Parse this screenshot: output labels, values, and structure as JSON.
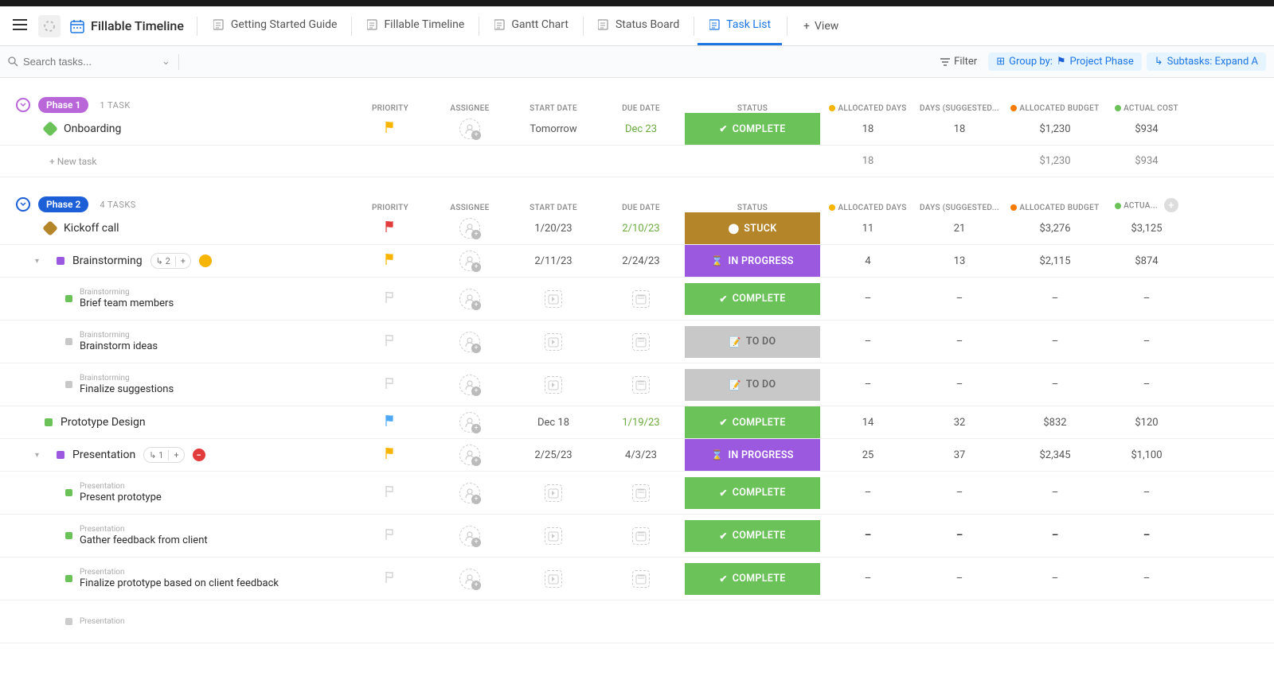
{
  "topbar": {
    "title": "Fillable Timeline",
    "tabs": [
      {
        "label": "Getting Started Guide"
      },
      {
        "label": "Fillable Timeline"
      },
      {
        "label": "Gantt Chart"
      },
      {
        "label": "Status Board"
      },
      {
        "label": "Task List",
        "active": true
      }
    ],
    "view": "View"
  },
  "filters": {
    "search_placeholder": "Search tasks...",
    "filter": "Filter",
    "group_by": "Group by:",
    "group_value": "Project Phase",
    "subtasks": "Subtasks: Expand A"
  },
  "columns": {
    "priority": "PRIORITY",
    "assignee": "ASSIGNEE",
    "start": "START DATE",
    "due": "DUE DATE",
    "status": "STATUS",
    "alloc_days": "ALLOCATED DAYS",
    "sugg_days": "DAYS (SUGGESTED...",
    "alloc_budget": "ALLOCATED BUDGET",
    "actual": "ACTUAL COST",
    "actual_short": "ACTUA..."
  },
  "colors": {
    "complete": "#6AC259",
    "stuck": "#B5852A",
    "inprogress": "#9B59E0",
    "todo": "#C8C8C8",
    "phase1": "#B866D8",
    "phase2": "#1C5FD6",
    "flag_yellow": "#F7B500",
    "flag_red": "#E23B3B",
    "flag_blue": "#4FA8F6"
  },
  "sections": [
    {
      "id": "phase1",
      "badge": "Phase 1",
      "badge_color": "#B866D8",
      "ring_color": "#B866D8",
      "count": "1 TASK",
      "tasks": [
        {
          "sq": "#6AC259",
          "sqshape": "diamond",
          "name": "Onboarding",
          "prio": "yellow",
          "start": "Tomorrow",
          "due": "Dec 23",
          "due_color": "#6aaa3e",
          "status": "COMPLETE",
          "status_bg": "#6AC259",
          "sicon": "✔",
          "alloc": "18",
          "sugg": "18",
          "budget": "$1,230",
          "actual": "$934"
        }
      ],
      "footer": {
        "alloc": "18",
        "budget": "$1,230",
        "actual": "$934"
      },
      "new_task": "+ New task"
    },
    {
      "id": "phase2",
      "badge": "Phase 2",
      "badge_color": "#1C5FD6",
      "ring_color": "#1C5FD6",
      "count": "4 TASKS",
      "header_actual_short": true,
      "tasks": [
        {
          "sq": "#B5852A",
          "sqshape": "diamond",
          "name": "Kickoff call",
          "prio": "red",
          "start": "1/20/23",
          "due": "2/10/23",
          "due_color": "#6aaa3e",
          "status": "STUCK",
          "status_bg": "#B5852A",
          "sicon": "⬤",
          "alloc": "11",
          "sugg": "21",
          "budget": "$3,276",
          "actual": "$3,125"
        },
        {
          "sq": "#9B59E0",
          "sqshape": "square",
          "caret": true,
          "name": "Brainstorming",
          "subcount": "2",
          "dot": "#F7B500",
          "prio": "yellow",
          "start": "2/11/23",
          "due": "2/24/23",
          "status": "IN PROGRESS",
          "status_bg": "#9B59E0",
          "sicon": "⌛",
          "alloc": "4",
          "sugg": "13",
          "budget": "$2,115",
          "actual": "$874"
        },
        {
          "subtask": true,
          "sq": "#6AC259",
          "parent": "Brainstorming",
          "name": "Brief team members",
          "status": "COMPLETE",
          "status_bg": "#6AC259",
          "sicon": "✔"
        },
        {
          "subtask": true,
          "sq": "#C8C8C8",
          "parent": "Brainstorming",
          "name": "Brainstorm ideas",
          "status": "TO DO",
          "status_bg": "#C8C8C8",
          "sicon": "📝",
          "status_fg": "#666"
        },
        {
          "subtask": true,
          "sq": "#C8C8C8",
          "parent": "Brainstorming",
          "name": "Finalize suggestions",
          "status": "TO DO",
          "status_bg": "#C8C8C8",
          "sicon": "📝",
          "status_fg": "#666"
        },
        {
          "sq": "#6AC259",
          "sqshape": "square",
          "name": "Prototype Design",
          "prio": "blue",
          "start": "Dec 18",
          "due": "1/19/23",
          "due_color": "#6aaa3e",
          "status": "COMPLETE",
          "status_bg": "#6AC259",
          "sicon": "✔",
          "alloc": "14",
          "sugg": "32",
          "budget": "$832",
          "actual": "$120"
        },
        {
          "sq": "#9B59E0",
          "sqshape": "square",
          "caret": true,
          "name": "Presentation",
          "subcount": "1",
          "dot": "#E23B3B",
          "doticon": "−",
          "prio": "yellow",
          "start": "2/25/23",
          "due": "4/3/23",
          "status": "IN PROGRESS",
          "status_bg": "#9B59E0",
          "sicon": "⌛",
          "alloc": "25",
          "sugg": "37",
          "budget": "$2,345",
          "actual": "$1,100"
        },
        {
          "subtask": true,
          "sq": "#6AC259",
          "parent": "Presentation",
          "name": "Present prototype",
          "status": "COMPLETE",
          "status_bg": "#6AC259",
          "sicon": "✔",
          "dashall": true
        },
        {
          "subtask": true,
          "sq": "#6AC259",
          "parent": "Presentation",
          "name": "Gather feedback from client",
          "status": "COMPLETE",
          "status_bg": "#6AC259",
          "sicon": "✔",
          "dashall": true,
          "bolddash": true
        },
        {
          "subtask": true,
          "sq": "#6AC259",
          "parent": "Presentation",
          "name": "Finalize prototype based on client feedback",
          "status": "COMPLETE",
          "status_bg": "#6AC259",
          "sicon": "✔",
          "dashall": true
        },
        {
          "subtask": true,
          "parent": "Presentation",
          "name": "",
          "trailing": true
        }
      ]
    }
  ]
}
